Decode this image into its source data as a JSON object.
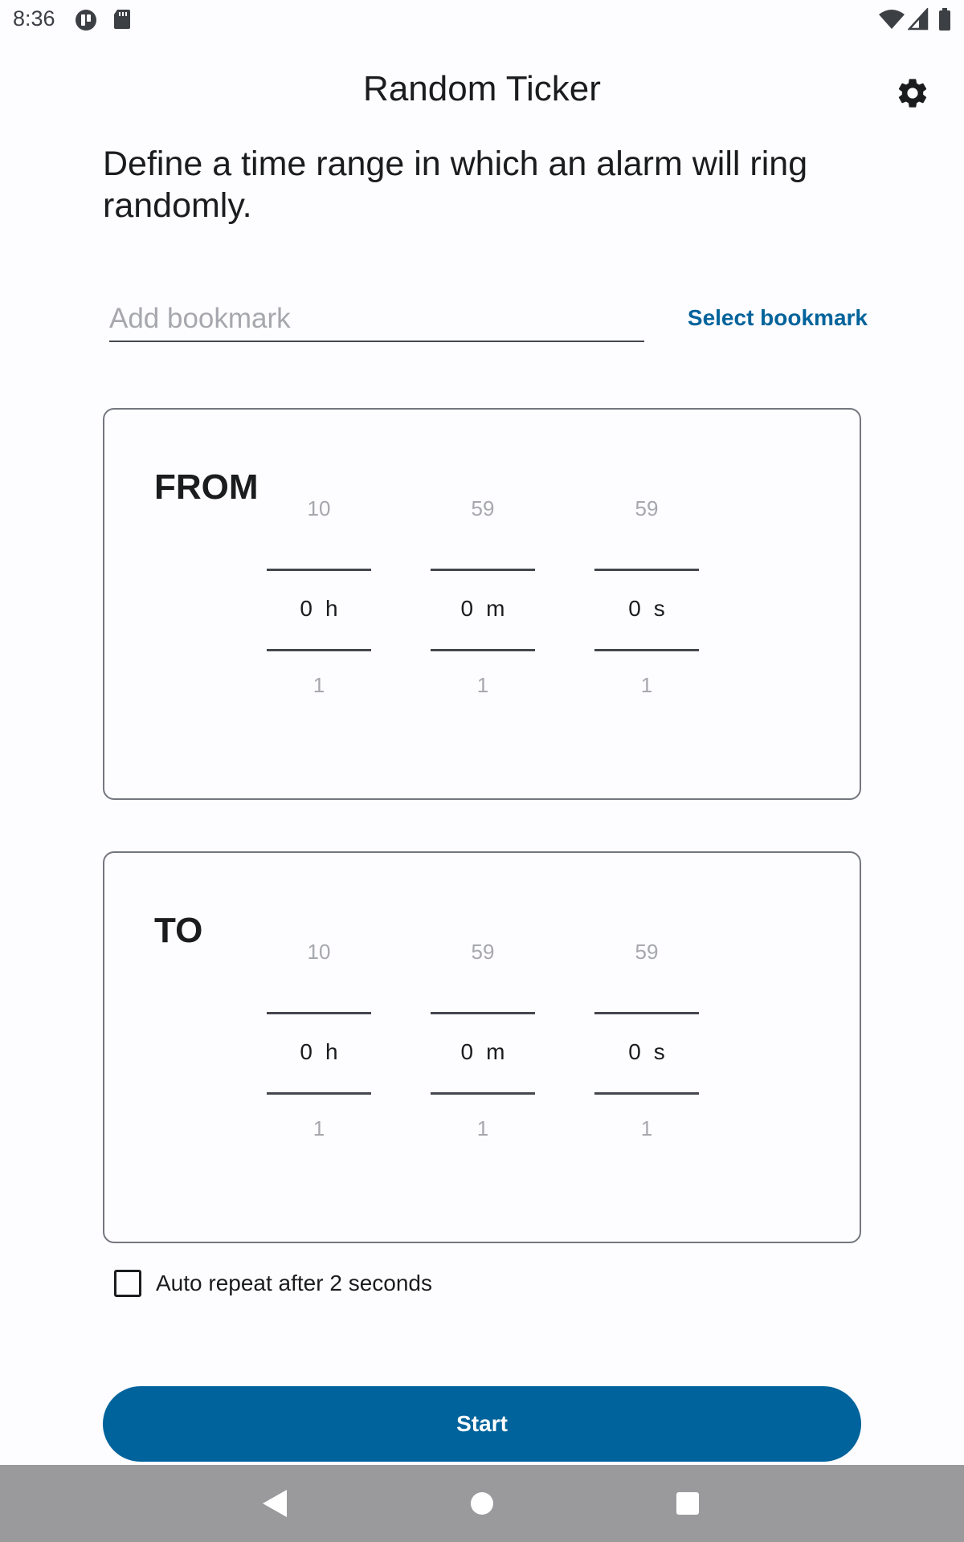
{
  "status_bar": {
    "time": "8:36",
    "icons": [
      "app-notification-icon",
      "sd-card-icon",
      "wifi-icon",
      "signal-icon",
      "battery-icon"
    ]
  },
  "app_bar": {
    "title": "Random Ticker",
    "settings_icon": "gear-icon"
  },
  "description": "Define a time range in which an alarm will ring randomly.",
  "bookmark": {
    "placeholder": "Add bookmark",
    "value": "",
    "select_label": "Select bookmark"
  },
  "ranges": {
    "from": {
      "label": "FROM",
      "hours": {
        "above": "10",
        "value": "0",
        "unit": "h",
        "below": "1"
      },
      "minutes": {
        "above": "59",
        "value": "0",
        "unit": "m",
        "below": "1"
      },
      "seconds": {
        "above": "59",
        "value": "0",
        "unit": "s",
        "below": "1"
      }
    },
    "to": {
      "label": "TO",
      "hours": {
        "above": "10",
        "value": "0",
        "unit": "h",
        "below": "1"
      },
      "minutes": {
        "above": "59",
        "value": "0",
        "unit": "m",
        "below": "1"
      },
      "seconds": {
        "above": "59",
        "value": "0",
        "unit": "s",
        "below": "1"
      }
    }
  },
  "auto_repeat": {
    "label": "Auto repeat after 2 seconds",
    "checked": false
  },
  "start_button": {
    "label": "Start"
  },
  "nav_bar": {
    "icons": [
      "back-icon",
      "home-icon",
      "recents-icon"
    ]
  },
  "colors": {
    "primary": "#00639b",
    "background": "#fdfcff",
    "outline": "#74777f",
    "nav_bar": "#9a9a9c"
  }
}
